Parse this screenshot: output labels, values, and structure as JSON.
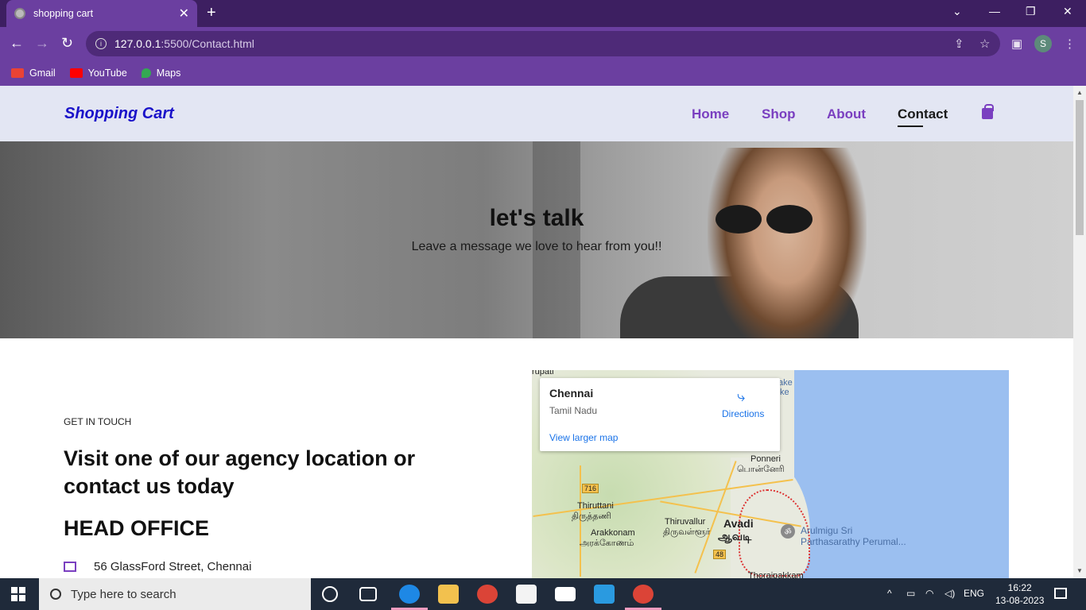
{
  "browser": {
    "tab_title": "shopping cart",
    "url_host": "127.0.0.1",
    "url_path": ":5500/Contact.html",
    "profile_initial": "S",
    "bookmarks": [
      {
        "label": "Gmail",
        "color": "#ea4335"
      },
      {
        "label": "YouTube",
        "color": "#ff0000"
      },
      {
        "label": "Maps",
        "color": "#34a853"
      }
    ]
  },
  "site": {
    "logo": "Shopping Cart",
    "nav": [
      {
        "label": "Home"
      },
      {
        "label": "Shop"
      },
      {
        "label": "About"
      },
      {
        "label": "Contact",
        "active": true
      }
    ],
    "accent": "#7a3fc0",
    "logo_color": "#1a12c9"
  },
  "hero": {
    "title": "let's talk",
    "subtitle": "Leave a message we love to hear from you!!"
  },
  "contact": {
    "eyebrow": "GET IN TOUCH",
    "heading": "Visit one of our agency location or contact us today",
    "office_title": "HEAD OFFICE",
    "address": "56 GlassFord Street, Chennai"
  },
  "map": {
    "place": "Chennai",
    "region": "Tamil Nadu",
    "directions": "Directions",
    "view_larger": "View larger map",
    "labels": {
      "tirupati": "rupati",
      "lake": "ake",
      "lake2": "ke",
      "ponneri": "Ponneri",
      "ponneri_ta": "பொன்னேரி",
      "tiruttani": "Thiruttani",
      "tiruttani_ta": "திருத்தணி",
      "arakkonam": "Arakkonam",
      "arakkonam_ta": "அரக்கோணம்",
      "tiruvallur": "Thiruvallur",
      "tiruvallur_ta": "திருவள்ளூர்",
      "avadi": "Avadi",
      "avadi_ta": "ஆவடி",
      "temple_1": "Arulmigu Sri",
      "temple_2": "Parthasarathy Perumal...",
      "thoraipakkam": "Thoraipakkam",
      "road_716": "716",
      "road_48": "48"
    }
  },
  "taskbar": {
    "search_placeholder": "Type here to search",
    "lang": "ENG",
    "time": "16:22",
    "date": "13-08-2023"
  }
}
